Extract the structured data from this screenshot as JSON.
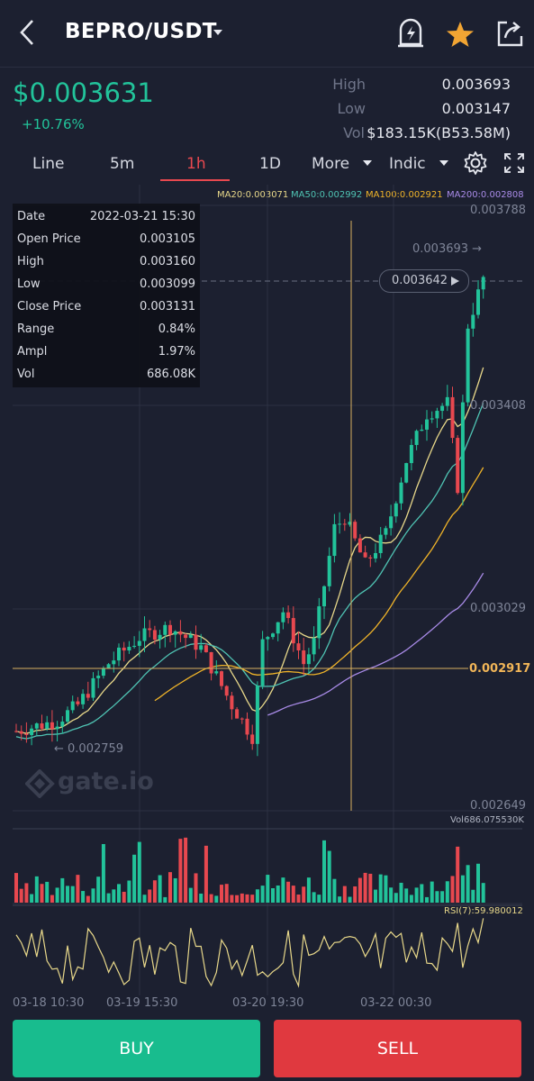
{
  "header": {
    "pair": "BEPRO/USDT",
    "back_icon": "chevron-left-icon",
    "dropdown_icon": "caret-down-icon",
    "alert_icon": "price-alert-icon",
    "favorite_icon": "star-icon",
    "share_icon": "share-icon"
  },
  "ticker": {
    "price": "$0.003631",
    "change": "+10.76%",
    "high_label": "High",
    "high_value": "0.003693",
    "low_label": "Low",
    "low_value": "0.003147",
    "vol_label": "Vol",
    "vol_value": "$183.15K(B53.58M)"
  },
  "tabs": {
    "line": "Line",
    "m5": "5m",
    "h1": "1h",
    "d1": "1D",
    "more": "More",
    "indic": "Indic"
  },
  "ma_legend": {
    "ma20": "MA20:0.003071",
    "ma50": "MA50:0.002992",
    "ma100": "MA100:0.002921",
    "ma200": "MA200:0.002808"
  },
  "ohlc": {
    "date_label": "Date",
    "date_value": "2022-03-21 15:30",
    "open_label": "Open Price",
    "open_value": "0.003105",
    "high_label": "High",
    "high_value": "0.003160",
    "low_label": "Low",
    "low_value": "0.003099",
    "close_label": "Close Price",
    "close_value": "0.003131",
    "range_label": "Range",
    "range_value": "0.84%",
    "ampl_label": "Ampl",
    "ampl_value": "1.97%",
    "vol_label": "Vol",
    "vol_value": "686.08K"
  },
  "price_axis": {
    "top": "0.003788",
    "p2": "0.003408",
    "p3": "0.003029",
    "cross": "0.002917",
    "bottom": "0.002649"
  },
  "chart_marks": {
    "max_marker": "0.003693 →",
    "current_price_pill": "0.003642",
    "min_marker": "← 0.002759",
    "watermark": "gate.io",
    "vol_indicator": "Vol686.075530K",
    "rsi_indicator": "RSI(7):59.980012"
  },
  "time_axis": [
    "03-18 10:30",
    "03-19 15:30",
    "03-20 19:30",
    "03-22 00:30"
  ],
  "actions": {
    "buy": "BUY",
    "sell": "SELL"
  },
  "colors": {
    "up": "#22c39a",
    "down": "#e8484f",
    "ma20": "#e8d88a",
    "ma50": "#4fc3b3",
    "ma100": "#f0b429",
    "ma200": "#a98be8"
  }
}
